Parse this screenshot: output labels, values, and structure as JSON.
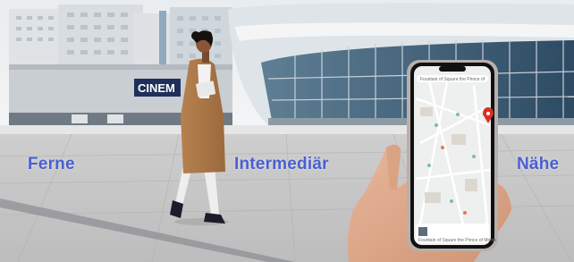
{
  "labels": {
    "left": "Ferne",
    "middle": "Intermediär",
    "right": "Nähe"
  },
  "signage": {
    "building_sign": "CINEM"
  },
  "phone": {
    "top_text": "Fountain of Square the Prince of",
    "bottom_text": "Fountain of Square the Prince of Monte"
  }
}
